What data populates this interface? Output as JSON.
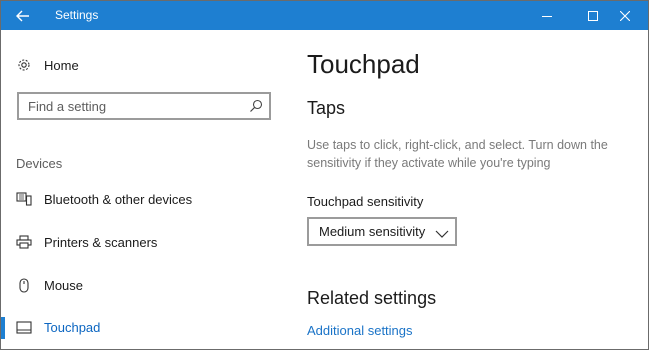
{
  "window": {
    "title": "Settings",
    "accent": "#1e7fd1",
    "controls": [
      "minimize-icon",
      "maximize-icon",
      "close-icon"
    ]
  },
  "sidebar": {
    "home_label": "Home",
    "search_placeholder": "Find a setting",
    "section_label": "Devices",
    "items": [
      {
        "label": "Bluetooth & other devices",
        "icon": "bluetooth-devices-icon"
      },
      {
        "label": "Printers & scanners",
        "icon": "printer-icon"
      },
      {
        "label": "Mouse",
        "icon": "mouse-icon"
      },
      {
        "label": "Touchpad",
        "icon": "touchpad-icon",
        "active": true
      }
    ]
  },
  "main": {
    "title": "Touchpad",
    "taps_heading": "Taps",
    "taps_description": "Use taps to click, right-click, and select. Turn down the sensitivity if they activate while you're typing",
    "sensitivity_label": "Touchpad sensitivity",
    "sensitivity_value": "Medium sensitivity",
    "related_heading": "Related settings",
    "additional_link": "Additional settings"
  }
}
